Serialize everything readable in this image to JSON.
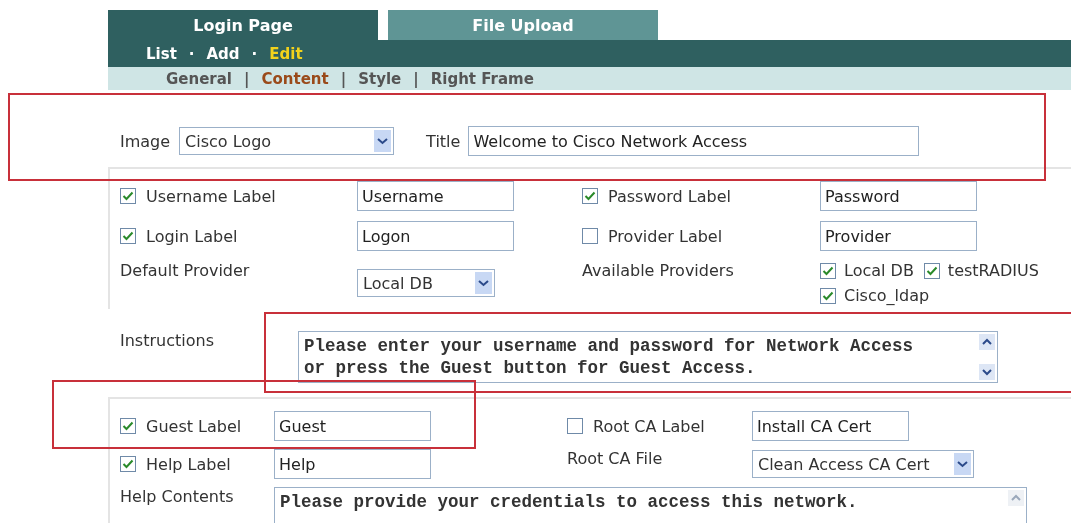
{
  "tabs": [
    {
      "label": "Login Page",
      "selected": true
    },
    {
      "label": "File Upload",
      "selected": false
    }
  ],
  "subnav": [
    {
      "kind": "link",
      "label": "List",
      "selected": false
    },
    {
      "kind": "separator",
      "label": "·"
    },
    {
      "kind": "link",
      "label": "Add",
      "selected": false
    },
    {
      "kind": "separator",
      "label": "·"
    },
    {
      "kind": "link",
      "label": "Edit",
      "selected": true
    }
  ],
  "section_nav": [
    {
      "kind": "link",
      "label": "General",
      "selected": false
    },
    {
      "kind": "separator",
      "label": "|"
    },
    {
      "kind": "link",
      "label": "Content",
      "selected": true
    },
    {
      "kind": "separator",
      "label": "|"
    },
    {
      "kind": "link",
      "label": "Style",
      "selected": false
    },
    {
      "kind": "separator",
      "label": "|"
    },
    {
      "kind": "link",
      "label": "Right Frame",
      "selected": false
    }
  ],
  "image": {
    "label": "Image",
    "value": "Cisco Logo"
  },
  "title": {
    "label": "Title",
    "value": "Welcome to Cisco Network Access"
  },
  "labels_panel": [
    {
      "kind": "check",
      "label": "Username Label",
      "checked": true,
      "value": "Username"
    },
    {
      "kind": "check",
      "label": "Password Label",
      "checked": true,
      "value": "Password"
    },
    {
      "kind": "check",
      "label": "Login Label",
      "checked": true,
      "value": "Logon"
    },
    {
      "kind": "check",
      "label": "Provider Label",
      "checked": false,
      "value": "Provider"
    },
    {
      "kind": "select",
      "label": "Default Provider",
      "value": "Local DB"
    },
    {
      "kind": "options",
      "label": "Available Providers",
      "options": [
        {
          "label": "Local DB",
          "checked": true
        },
        {
          "label": "testRADIUS",
          "checked": true
        },
        {
          "label": "Cisco_ldap",
          "checked": true
        }
      ]
    }
  ],
  "instructions": {
    "label": "Instructions",
    "value": "Please enter your username and password for Network Access\nor press the Guest button for Guest Access."
  },
  "extras_panel": [
    {
      "kind": "check",
      "label": "Guest Label",
      "checked": true,
      "value": "Guest"
    },
    {
      "kind": "check",
      "label": "Root CA Label",
      "checked": false,
      "value": "Install CA Cert"
    },
    {
      "kind": "check",
      "label": "Help Label",
      "checked": true,
      "value": "Help"
    },
    {
      "kind": "select",
      "label": "Root CA File",
      "value": "Clean Access CA Cert"
    },
    {
      "kind": "textarea",
      "label": "Help Contents",
      "value": "Please provide your credentials to access this network."
    }
  ]
}
